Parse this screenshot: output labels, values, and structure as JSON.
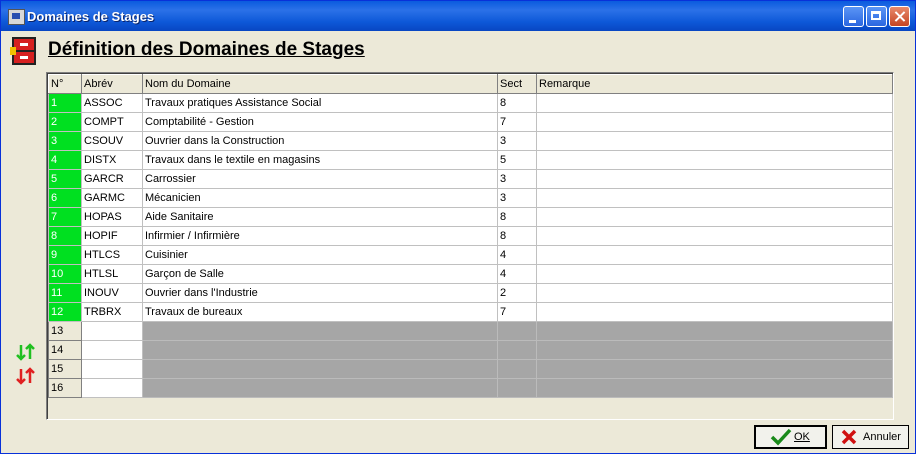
{
  "window": {
    "title": "Domaines de Stages"
  },
  "heading": "Définition des Domaines de Stages",
  "grid": {
    "headers": [
      "N°",
      "Abrév",
      "Nom du Domaine",
      "Sect",
      "Remarque"
    ],
    "rows": [
      {
        "n": "1",
        "abrev": "ASSOC",
        "nom": "Travaux pratiques Assistance Social",
        "sect": "8",
        "remarque": ""
      },
      {
        "n": "2",
        "abrev": "COMPT",
        "nom": "Comptabilité - Gestion",
        "sect": "7",
        "remarque": ""
      },
      {
        "n": "3",
        "abrev": "CSOUV",
        "nom": "Ouvrier dans la Construction",
        "sect": "3",
        "remarque": ""
      },
      {
        "n": "4",
        "abrev": "DISTX",
        "nom": "Travaux dans le textile en magasins",
        "sect": "5",
        "remarque": ""
      },
      {
        "n": "5",
        "abrev": "GARCR",
        "nom": "Carrossier",
        "sect": "3",
        "remarque": ""
      },
      {
        "n": "6",
        "abrev": "GARMC",
        "nom": "Mécanicien",
        "sect": "3",
        "remarque": ""
      },
      {
        "n": "7",
        "abrev": "HOPAS",
        "nom": "Aide Sanitaire",
        "sect": "8",
        "remarque": ""
      },
      {
        "n": "8",
        "abrev": "HOPIF",
        "nom": "Infirmier / Infirmière",
        "sect": "8",
        "remarque": ""
      },
      {
        "n": "9",
        "abrev": "HTLCS",
        "nom": "Cuisinier",
        "sect": "4",
        "remarque": ""
      },
      {
        "n": "10",
        "abrev": "HTLSL",
        "nom": "Garçon de Salle",
        "sect": "4",
        "remarque": ""
      },
      {
        "n": "11",
        "abrev": "INOUV",
        "nom": "Ouvrier dans l'Industrie",
        "sect": "2",
        "remarque": ""
      },
      {
        "n": "12",
        "abrev": "TRBRX",
        "nom": "Travaux de bureaux",
        "sect": "7",
        "remarque": ""
      }
    ],
    "empty_rows": [
      "13",
      "14",
      "15",
      "16"
    ]
  },
  "buttons": {
    "ok": "OK",
    "cancel": "Annuler"
  },
  "colors": {
    "filled_row_number": "#00e020",
    "empty_cell": "#a6a6a6",
    "titlebar": "#0a5bde"
  },
  "icons": {
    "sort_up": "sort-arrows-green-icon",
    "sort_down": "sort-arrows-red-icon",
    "ok": "checkmark-icon",
    "cancel": "red-x-icon",
    "heading": "cabinet-icon"
  }
}
